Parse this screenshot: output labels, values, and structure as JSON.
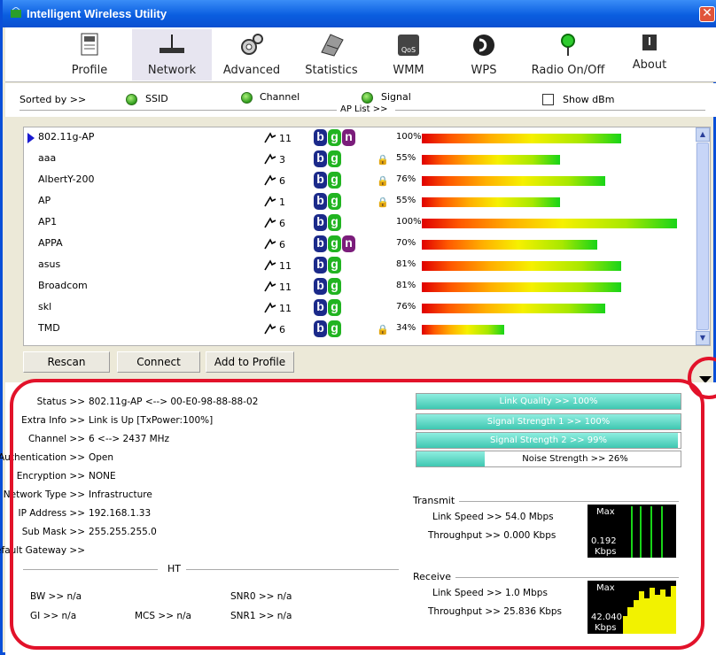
{
  "window": {
    "title": "Intelligent Wireless Utility",
    "close": "✕"
  },
  "toolbar": {
    "items": [
      {
        "label": "Profile",
        "icon": "profile-icon"
      },
      {
        "label": "Network",
        "icon": "network-icon"
      },
      {
        "label": "Advanced",
        "icon": "advanced-icon"
      },
      {
        "label": "Statistics",
        "icon": "statistics-icon"
      },
      {
        "label": "WMM",
        "icon": "wmm-icon"
      },
      {
        "label": "WPS",
        "icon": "wps-icon"
      },
      {
        "label": "Radio On/Off",
        "icon": "radio-icon"
      },
      {
        "label": "About",
        "icon": "about-icon"
      }
    ]
  },
  "sort": {
    "prefix": "Sorted by >>",
    "ssid": "SSID",
    "channel": "Channel",
    "signal": "Signal",
    "show_dbm": "Show dBm",
    "ap_list": "AP List >>"
  },
  "aps": [
    {
      "ssid": "802.11g-AP",
      "channel": "11",
      "n": true,
      "lock": false,
      "signal": "100%",
      "bar": 0.75
    },
    {
      "ssid": "aaa",
      "channel": "3",
      "n": false,
      "lock": true,
      "signal": "55%",
      "bar": 0.52
    },
    {
      "ssid": "AlbertY-200",
      "channel": "6",
      "n": false,
      "lock": true,
      "signal": "76%",
      "bar": 0.69
    },
    {
      "ssid": "AP",
      "channel": "1",
      "n": false,
      "lock": true,
      "signal": "55%",
      "bar": 0.52
    },
    {
      "ssid": "AP1",
      "channel": "6",
      "n": false,
      "lock": false,
      "signal": "100%",
      "bar": 0.96
    },
    {
      "ssid": "APPA",
      "channel": "6",
      "n": true,
      "lock": false,
      "signal": "70%",
      "bar": 0.66
    },
    {
      "ssid": "asus",
      "channel": "11",
      "n": false,
      "lock": false,
      "signal": "81%",
      "bar": 0.75
    },
    {
      "ssid": "Broadcom",
      "channel": "11",
      "n": false,
      "lock": false,
      "signal": "81%",
      "bar": 0.75
    },
    {
      "ssid": "skl",
      "channel": "11",
      "n": false,
      "lock": false,
      "signal": "76%",
      "bar": 0.69
    },
    {
      "ssid": "TMD",
      "channel": "6",
      "n": false,
      "lock": true,
      "signal": "34%",
      "bar": 0.31
    }
  ],
  "buttons": {
    "rescan": "Rescan",
    "connect": "Connect",
    "add_profile": "Add to Profile"
  },
  "status": {
    "status_k": "Status >>",
    "status_v": "802.11g-AP <--> 00-E0-98-88-88-02",
    "extra_k": "Extra Info >>",
    "extra_v": "Link is Up [TxPower:100%]",
    "channel_k": "Channel >>",
    "channel_v": "6 <--> 2437 MHz",
    "auth_k": "Authentication >>",
    "auth_v": "Open",
    "enc_k": "Encryption >>",
    "enc_v": "NONE",
    "nettype_k": "Network Type >>",
    "nettype_v": "Infrastructure",
    "ip_k": "IP Address >>",
    "ip_v": "192.168.1.33",
    "mask_k": "Sub Mask >>",
    "mask_v": "255.255.255.0",
    "gw_k": "Default Gateway >>",
    "gw_v": "",
    "ht": "HT",
    "bw": "BW >> n/a",
    "gi": "GI >> n/a",
    "mcs": "MCS >> n/a",
    "snr0": "SNR0 >> n/a",
    "snr1": "SNR1 >> n/a"
  },
  "quality": {
    "link": {
      "label": "Link Quality >> 100%",
      "level": 1.0
    },
    "sig1": {
      "label": "Signal Strength 1 >> 100%",
      "level": 1.0
    },
    "sig2": {
      "label": "Signal Strength 2 >> 99%",
      "level": 0.99
    },
    "noise": {
      "label": "Noise Strength >> 26%",
      "level": 0.26
    }
  },
  "transmit": {
    "title": "Transmit",
    "link_speed": "Link Speed >> 54.0 Mbps",
    "throughput": "Throughput >> 0.000 Kbps",
    "max": "Max",
    "value": "0.192",
    "unit": "Kbps"
  },
  "receive": {
    "title": "Receive",
    "link_speed": "Link Speed >> 1.0 Mbps",
    "throughput": "Throughput >> 25.836 Kbps",
    "max": "Max",
    "value": "42.040",
    "unit": "Kbps"
  }
}
